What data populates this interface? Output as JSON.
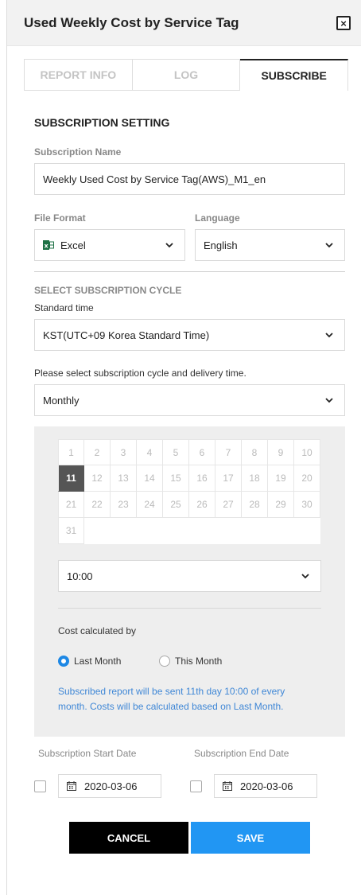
{
  "header": {
    "title": "Used Weekly Cost by Service Tag",
    "close_glyph": "×"
  },
  "tabs": [
    {
      "label": "REPORT INFO",
      "active": false
    },
    {
      "label": "LOG",
      "active": false
    },
    {
      "label": "SUBSCRIBE",
      "active": true
    }
  ],
  "subscription": {
    "section_title": "SUBSCRIPTION SETTING",
    "name_label": "Subscription Name",
    "name_value": "Weekly Used Cost by Service Tag(AWS)_M1_en",
    "file_format_label": "File Format",
    "file_format_value": "Excel",
    "file_format_icon": "excel-icon",
    "language_label": "Language",
    "language_value": "English"
  },
  "cycle": {
    "section_label": "SELECT SUBSCRIPTION CYCLE",
    "standard_time_label": "Standard time",
    "standard_time_value": "KST(UTC+09 Korea Standard Time)",
    "cycle_prompt": "Please select subscription cycle and delivery time.",
    "cycle_value": "Monthly",
    "days": [
      "1",
      "2",
      "3",
      "4",
      "5",
      "6",
      "7",
      "8",
      "9",
      "10",
      "11",
      "12",
      "13",
      "14",
      "15",
      "16",
      "17",
      "18",
      "19",
      "20",
      "21",
      "22",
      "23",
      "24",
      "25",
      "26",
      "27",
      "28",
      "29",
      "30",
      "31"
    ],
    "selected_day": "11",
    "time_value": "10:00",
    "cost_label": "Cost calculated by",
    "option_last_month": "Last Month",
    "option_this_month": "This Month",
    "selected_option": "Last Month",
    "info_text": "Subscribed report will be sent 11th day 10:00 of every month. Costs will be calculated based on Last Month."
  },
  "dates": {
    "start_label": "Subscription Start Date",
    "start_value": "2020-03-06",
    "end_label": "Subscription End Date",
    "end_value": "2020-03-06"
  },
  "buttons": {
    "cancel": "CANCEL",
    "save": "SAVE"
  },
  "colors": {
    "accent_blue": "#2196f3",
    "info_blue": "#3f87d6",
    "cancel_black": "#000000",
    "selected_day_bg": "#555555",
    "panel_gray": "#eeeeee"
  }
}
